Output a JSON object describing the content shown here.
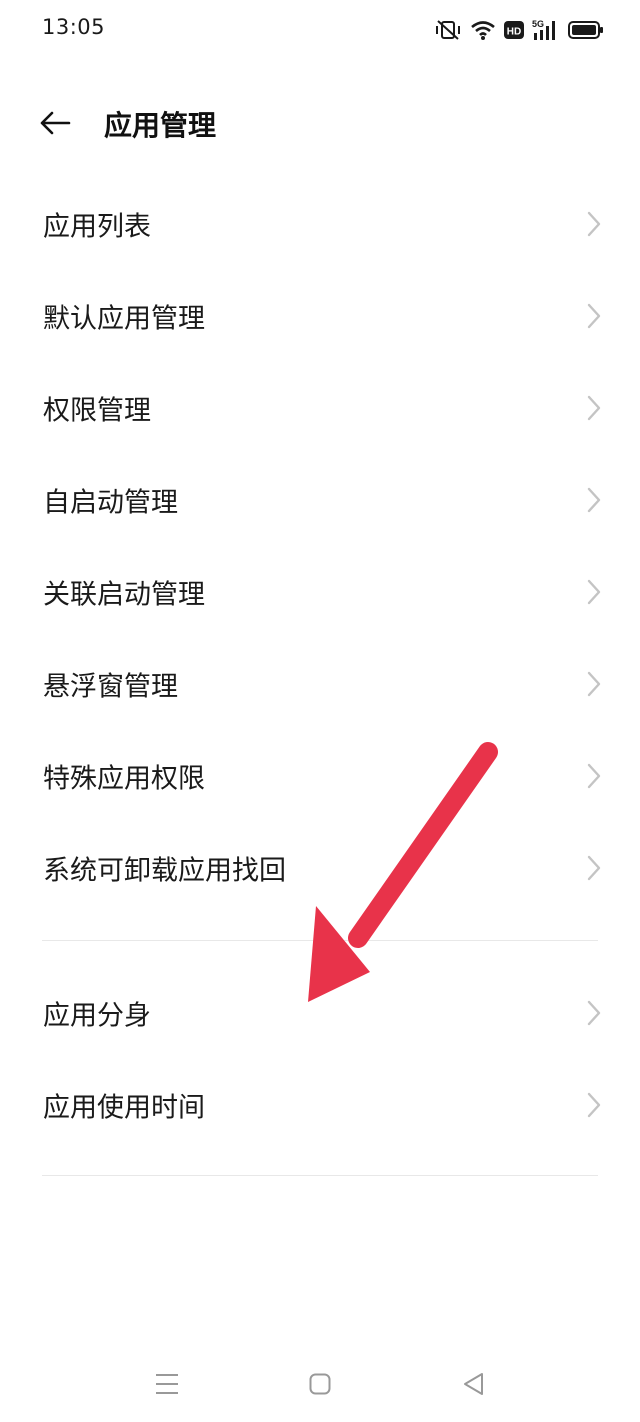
{
  "status_bar": {
    "time": "13:05",
    "icons": [
      "mute-vibrate-icon",
      "wifi-icon",
      "hd-icon",
      "5g-signal-icon",
      "battery-icon"
    ],
    "hd_text": "HD",
    "network_text": "5G"
  },
  "header": {
    "title": "应用管理",
    "back_icon": "arrow-left-icon"
  },
  "group1": [
    {
      "label": "应用列表"
    },
    {
      "label": "默认应用管理"
    },
    {
      "label": "权限管理"
    },
    {
      "label": "自启动管理"
    },
    {
      "label": "关联启动管理"
    },
    {
      "label": "悬浮窗管理"
    },
    {
      "label": "特殊应用权限"
    },
    {
      "label": "系统可卸载应用找回"
    }
  ],
  "group2": [
    {
      "label": "应用分身"
    },
    {
      "label": "应用使用时间"
    }
  ],
  "annotation": {
    "color": "#e8334a",
    "icon": "red-arrow-annotation"
  },
  "nav_bar": {
    "icons": [
      "menu-lines-icon",
      "home-square-icon",
      "back-triangle-icon"
    ]
  }
}
